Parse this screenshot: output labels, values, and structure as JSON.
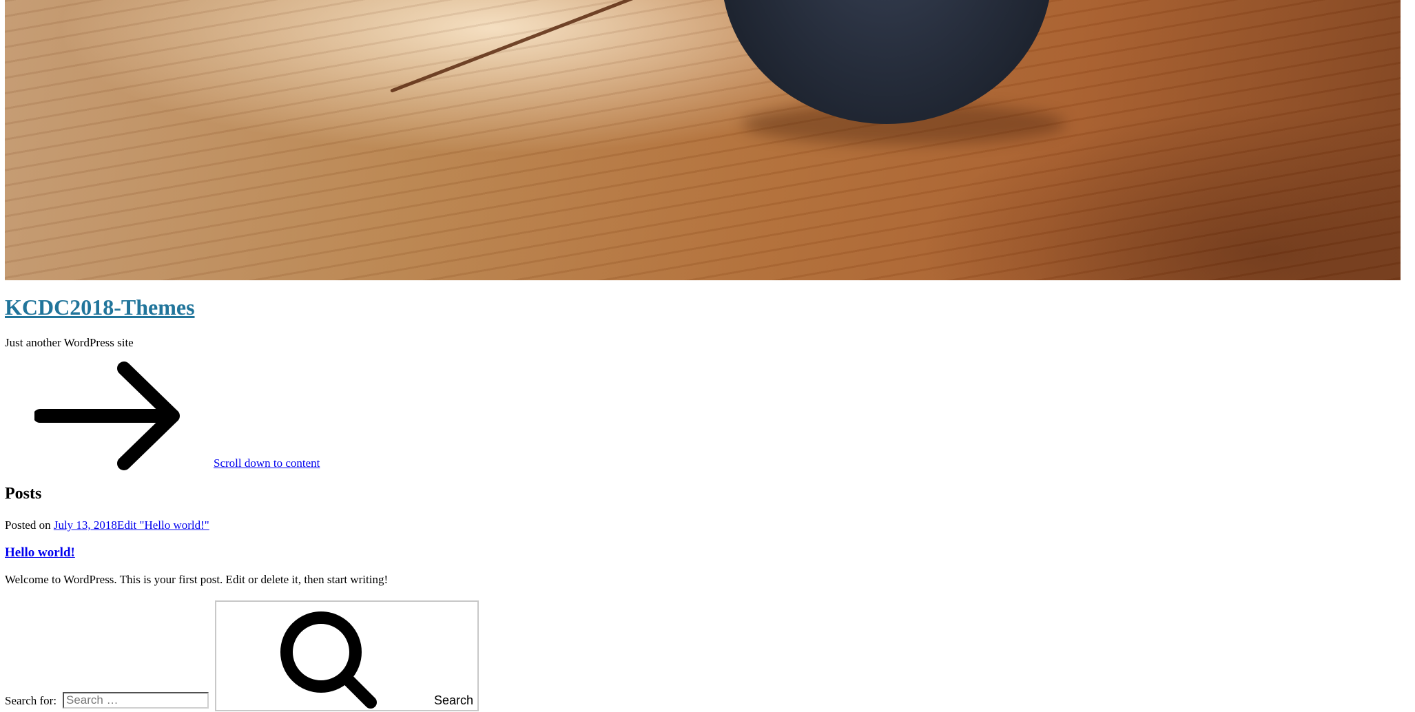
{
  "header": {
    "image_alt": "Header image: smart speaker on a wooden table",
    "site_title": "KCDC2018-Themes",
    "tagline": "Just another WordPress site",
    "scroll_link": "Scroll down to content",
    "scroll_icon": "arrow-right-icon"
  },
  "main": {
    "heading": "Posts",
    "posts": [
      {
        "posted_on_prefix": "Posted on ",
        "date": "July 13, 2018",
        "edit_link": "Edit \"Hello world!\"",
        "title": "Hello world!",
        "excerpt": "Welcome to WordPress. This is your first post. Edit or delete it, then start writing!"
      }
    ]
  },
  "search": {
    "label": "Search for: ",
    "placeholder": "Search …",
    "value": "",
    "button_label": "Search",
    "button_icon": "search-icon"
  },
  "colors": {
    "site_title_link": "#21759b",
    "link": "#0000ee",
    "text": "#000000",
    "background": "#ffffff"
  }
}
